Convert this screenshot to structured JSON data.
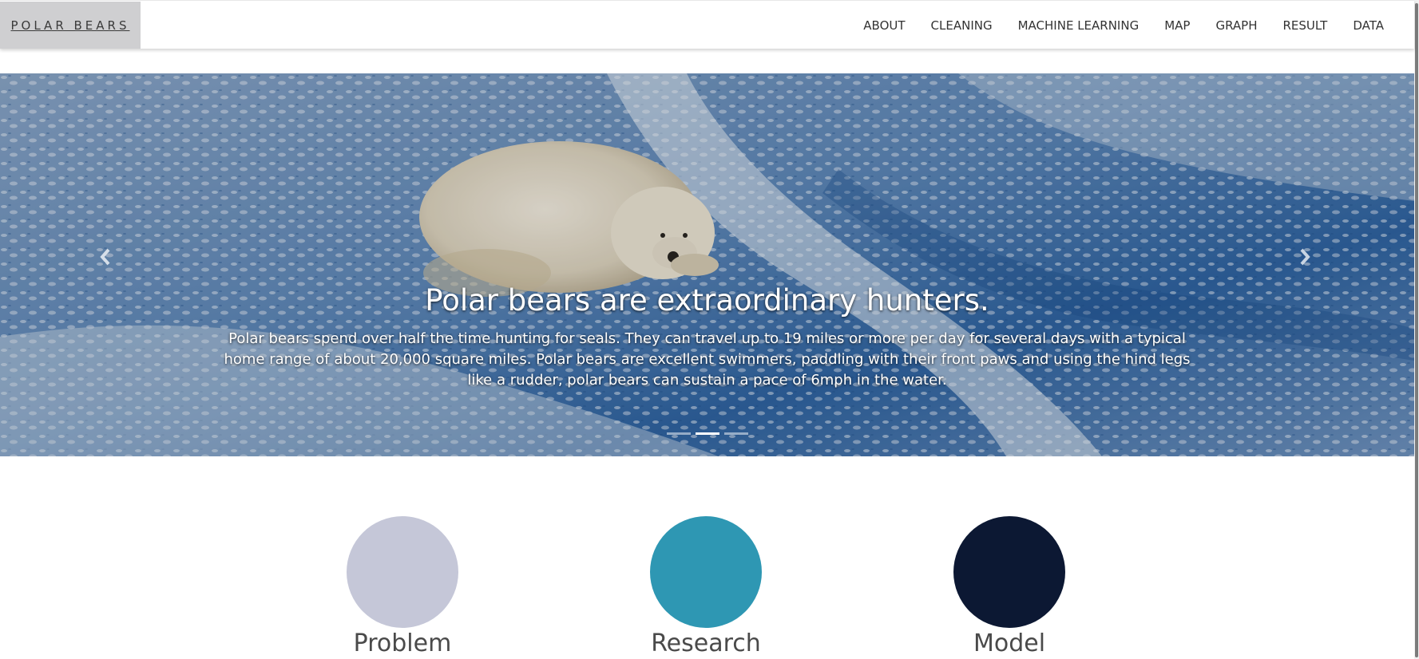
{
  "navbar": {
    "brand": "POLAR BEARS",
    "links": [
      "ABOUT",
      "CLEANING",
      "MACHINE LEARNING",
      "MAP",
      "GRAPH",
      "RESULT",
      "DATA"
    ]
  },
  "carousel": {
    "title": "Polar bears are extraordinary hunters.",
    "text": "Polar bears spend over half the time hunting for seals. They can travel up to 19 miles or more per day for several days with a typical home range of about 20,000 square miles. Polar bears are excellent swimmers, paddling with their front paws and using the hind legs like a rudder, polar bears can sustain a pace of 6mph in the water.",
    "prev_icon": "chevron-left-icon",
    "next_icon": "chevron-right-icon",
    "slide_count": 3,
    "active_slide": 2
  },
  "features": [
    {
      "label": "Problem",
      "color": "#c5c7d8"
    },
    {
      "label": "Research",
      "color": "#2e97b3"
    },
    {
      "label": "Model",
      "color": "#0c1833"
    }
  ],
  "colors": {
    "brand_bg": "#cfcfd1",
    "snow_blue": "#3d6fa3"
  }
}
